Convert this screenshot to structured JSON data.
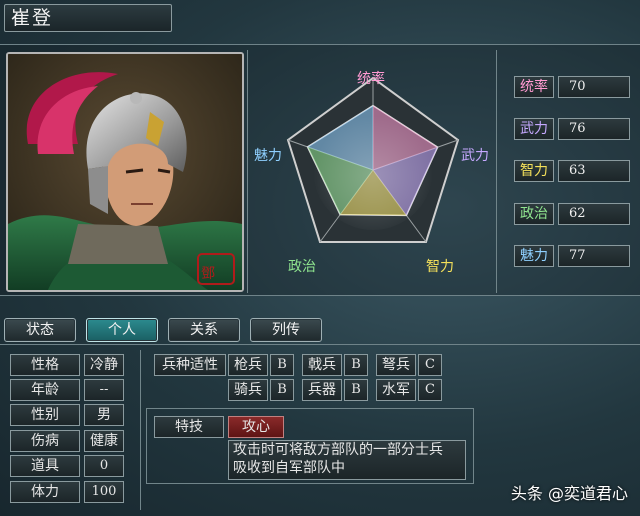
{
  "header": {
    "name": "崔登"
  },
  "radar": {
    "labels": {
      "top": "统率",
      "right": "武力",
      "bottom_right": "智力",
      "bottom_left": "政治",
      "left": "魅力"
    }
  },
  "stats": [
    {
      "label": "统率",
      "value": "70",
      "color": "#ff9ad2"
    },
    {
      "label": "武力",
      "value": "76",
      "color": "#c6a8ff"
    },
    {
      "label": "智力",
      "value": "63",
      "color": "#f4e05a"
    },
    {
      "label": "政治",
      "value": "62",
      "color": "#8fe58f"
    },
    {
      "label": "魅力",
      "value": "77",
      "color": "#8fd0ff"
    }
  ],
  "tabs": [
    "状态",
    "个人",
    "关系",
    "列传"
  ],
  "personal": {
    "personality_label": "性格",
    "personality": "冷静",
    "age_label": "年龄",
    "age": "--",
    "gender_label": "性别",
    "gender": "男",
    "injury_label": "伤病",
    "injury": "健康",
    "items_label": "道具",
    "items": "0",
    "hp_label": "体力",
    "hp": "100"
  },
  "aptitude": {
    "label": "兵种适性",
    "units": [
      {
        "name": "枪兵",
        "grade": "B"
      },
      {
        "name": "戟兵",
        "grade": "B"
      },
      {
        "name": "弩兵",
        "grade": "C"
      },
      {
        "name": "骑兵",
        "grade": "B"
      },
      {
        "name": "兵器",
        "grade": "B"
      },
      {
        "name": "水军",
        "grade": "C"
      }
    ]
  },
  "skill": {
    "label": "特技",
    "name": "攻心",
    "desc_line1": "攻击时可将敌方部队的一部分士兵",
    "desc_line2": "吸收到自军部队中"
  },
  "watermark": "头条 @奕道君心",
  "colors": {
    "active_tab": "#2c8b8f",
    "skill_name_bg": "#7a1f1f"
  }
}
